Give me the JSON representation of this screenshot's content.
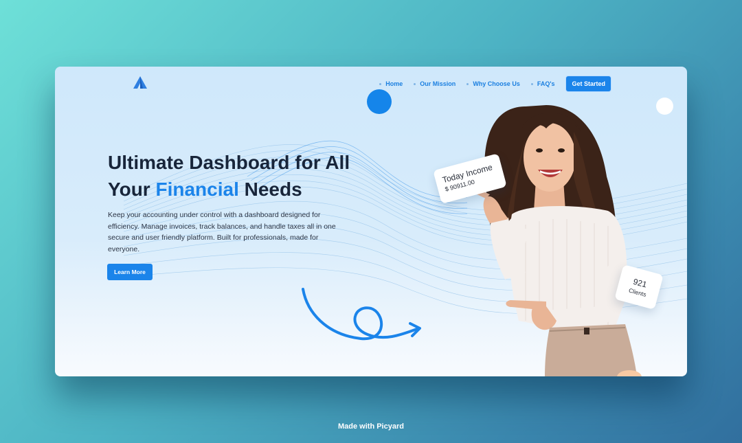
{
  "nav": {
    "items": [
      {
        "label": "Home"
      },
      {
        "label": "Our Mission"
      },
      {
        "label": "Why Choose Us"
      },
      {
        "label": "FAQ's"
      }
    ],
    "cta_label": "Get Started"
  },
  "hero": {
    "title_line1": "Ultimate Dashboard for All",
    "title_line2_prefix": "Your",
    "title_line2_accent": "Financial",
    "title_line2_suffix": "Needs",
    "description": "Keep your accounting under control with a dashboard designed for efficiency. Manage invoices, track balances, and handle taxes all in one secure and user friendly platform. Built for professionals, made for everyone.",
    "button_label": "Learn More"
  },
  "income_card": {
    "title": "Today Income",
    "value": "$ 90911.00"
  },
  "clients_card": {
    "value": "921",
    "label": "Clients"
  },
  "footer": {
    "text": "Made with Picyard"
  },
  "colors": {
    "accent": "#1b84ea",
    "heading": "#18253a",
    "background_teal": "#4db3c4"
  }
}
